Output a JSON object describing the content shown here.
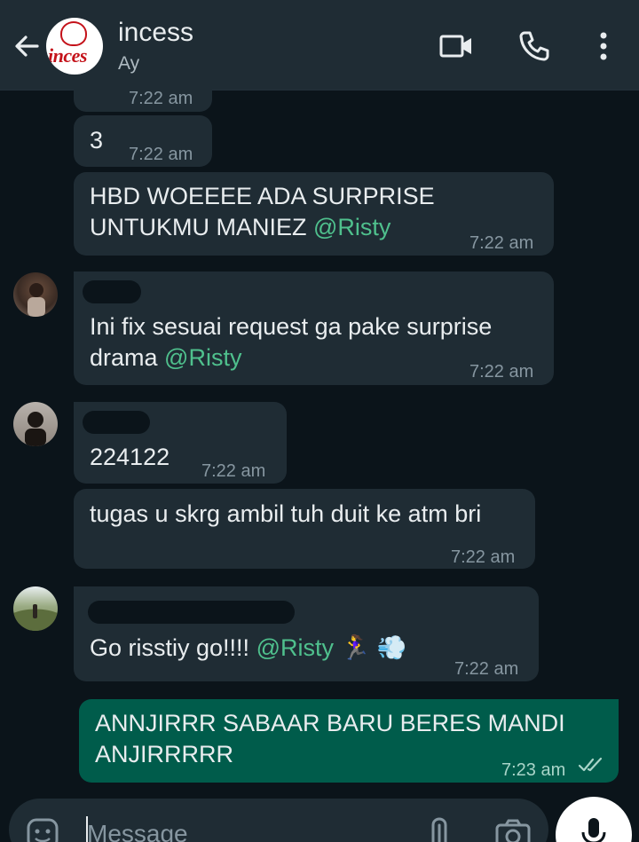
{
  "header": {
    "title": "incess",
    "subtitle": "Ay",
    "avatar_text": "inces"
  },
  "messages": [
    {
      "text": "",
      "time": "7:22 am"
    },
    {
      "text": "3",
      "time": "7:22 am"
    },
    {
      "text": "HBD WOEEEE ADA SURPRISE\nUNTUKMU MANIEZ ",
      "mention": "@Risty",
      "time": "7:22 am"
    },
    {
      "text": "Ini fix sesuai request ga pake surprise\ndrama ",
      "mention": "@Risty",
      "time": "7:22 am"
    },
    {
      "text": "224122",
      "time": "7:22 am"
    },
    {
      "text": "tugas u skrg ambil tuh duit ke atm bri",
      "time": "7:22 am"
    },
    {
      "text": "Go risstiy go!!!! ",
      "mention": "@Risty",
      "emoji": "🏃‍♀️ 💨",
      "time": "7:22 am"
    },
    {
      "text": "ANNJIRRR SABAAR BARU BERES MANDI\nANJIRRRRR",
      "time": "7:23 am",
      "outgoing": true
    }
  ],
  "composer": {
    "placeholder": "Message"
  },
  "colors": {
    "background": "#0b141a",
    "header": "#1f2c34",
    "incoming_bubble": "#1f2c34",
    "outgoing_bubble": "#005c4b",
    "mention": "#4fc08d"
  }
}
